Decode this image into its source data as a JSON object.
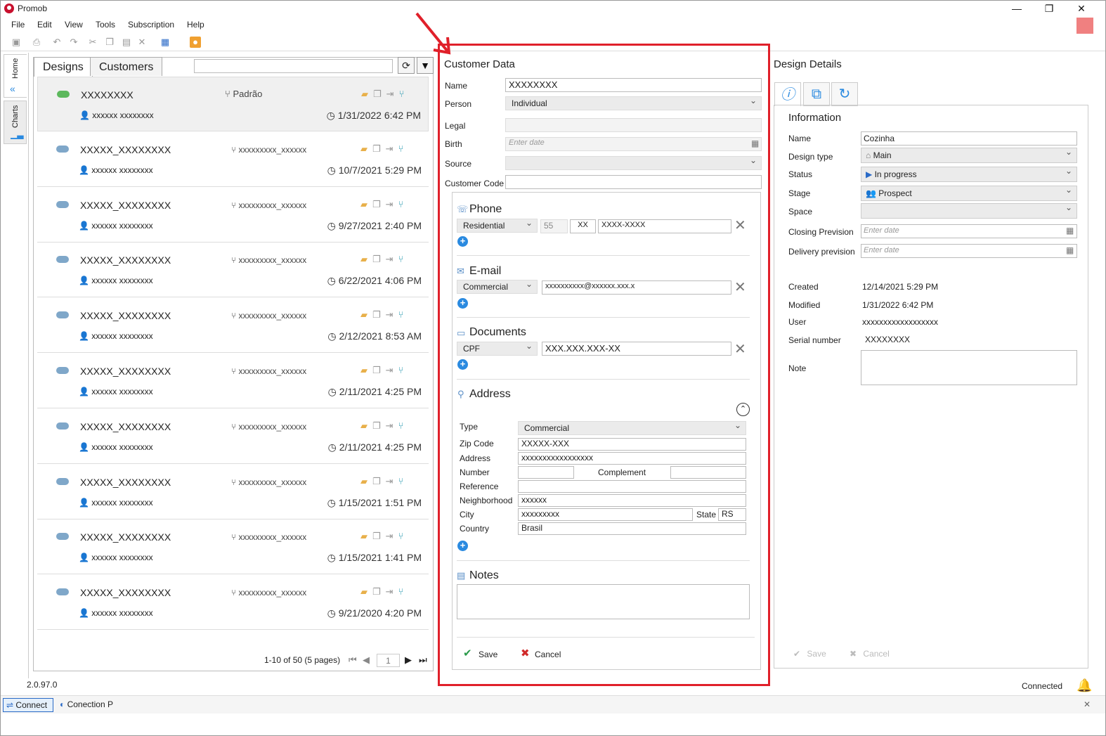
{
  "window": {
    "title": "Promob"
  },
  "menu": [
    "File",
    "Edit",
    "View",
    "Tools",
    "Subscription",
    "Help"
  ],
  "side_tabs": [
    "Home",
    "Charts"
  ],
  "designs_panel": {
    "tabs": [
      "Designs",
      "Customers"
    ],
    "rows": [
      {
        "name": "XXXXXXXX",
        "user": "xxxxxx xxxxxxxx",
        "branch": "Padrão",
        "date": "1/31/2022 6:42 PM",
        "cloud": "green"
      },
      {
        "name": "XXXXX_XXXXXXXX",
        "user": "xxxxxx xxxxxxxx",
        "branch": "xxxxxxxxx_xxxxxx",
        "date": "10/7/2021 5:29 PM",
        "cloud": "blue"
      },
      {
        "name": "XXXXX_XXXXXXXX",
        "user": "xxxxxx xxxxxxxx",
        "branch": "xxxxxxxxx_xxxxxx",
        "date": "9/27/2021 2:40 PM",
        "cloud": "blue"
      },
      {
        "name": "XXXXX_XXXXXXXX",
        "user": "xxxxxx xxxxxxxx",
        "branch": "xxxxxxxxx_xxxxxx",
        "date": "6/22/2021 4:06 PM",
        "cloud": "blue"
      },
      {
        "name": "XXXXX_XXXXXXXX",
        "user": "xxxxxx xxxxxxxx",
        "branch": "xxxxxxxxx_xxxxxx",
        "date": "2/12/2021 8:53 AM",
        "cloud": "blue"
      },
      {
        "name": "XXXXX_XXXXXXXX",
        "user": "xxxxxx xxxxxxxx",
        "branch": "xxxxxxxxx_xxxxxx",
        "date": "2/11/2021 4:25 PM",
        "cloud": "blue"
      },
      {
        "name": "XXXXX_XXXXXXXX",
        "user": "xxxxxx xxxxxxxx",
        "branch": "xxxxxxxxx_xxxxxx",
        "date": "2/11/2021 4:25 PM",
        "cloud": "blue"
      },
      {
        "name": "XXXXX_XXXXXXXX",
        "user": "xxxxxx xxxxxxxx",
        "branch": "xxxxxxxxx_xxxxxx",
        "date": "1/15/2021 1:51 PM",
        "cloud": "blue"
      },
      {
        "name": "XXXXX_XXXXXXXX",
        "user": "xxxxxx xxxxxxxx",
        "branch": "xxxxxxxxx_xxxxxx",
        "date": "1/15/2021 1:41 PM",
        "cloud": "blue"
      },
      {
        "name": "XXXXX_XXXXXXXX",
        "user": "xxxxxx xxxxxxxx",
        "branch": "xxxxxxxxx_xxxxxx",
        "date": "9/21/2020 4:20 PM",
        "cloud": "blue"
      }
    ],
    "pager": {
      "summary": "1-10 of 50 (5 pages)",
      "page": "1"
    }
  },
  "customer": {
    "title": "Customer Data",
    "name_label": "Name",
    "name_value": "XXXXXXXX",
    "person_label": "Person",
    "person_value": "Individual",
    "legal_label": "Legal",
    "birth_label": "Birth",
    "birth_placeholder": "Enter date",
    "source_label": "Source",
    "code_label": "Customer Code",
    "phone": {
      "title": "Phone",
      "type": "Residential",
      "country": "55",
      "area": "XX",
      "number": "XXXX-XXXX"
    },
    "email": {
      "title": "E-mail",
      "type": "Commercial",
      "value": "xxxxxxxxxx@xxxxxx.xxx.x"
    },
    "documents": {
      "title": "Documents",
      "type": "CPF",
      "value": "XXX.XXX.XXX-XX"
    },
    "address": {
      "title": "Address",
      "type_label": "Type",
      "type_value": "Commercial",
      "zip_label": "Zip Code",
      "zip_value": "XXXXX-XXX",
      "address_label": "Address",
      "address_value": "xxxxxxxxxxxxxxxxx",
      "number_label": "Number",
      "complement_label": "Complement",
      "reference_label": "Reference",
      "neighborhood_label": "Neighborhood",
      "neighborhood_value": "xxxxxx",
      "city_label": "City",
      "city_value": "xxxxxxxxx",
      "state_label": "State",
      "state_value": "RS",
      "country_label": "Country",
      "country_value": "Brasil"
    },
    "notes_title": "Notes",
    "save": "Save",
    "cancel": "Cancel"
  },
  "design_details": {
    "title": "Design Details",
    "section": "Information",
    "name_label": "Name",
    "name_value": "Cozinha",
    "type_label": "Design type",
    "type_value": "Main",
    "status_label": "Status",
    "status_value": "In progress",
    "stage_label": "Stage",
    "stage_value": "Prospect",
    "space_label": "Space",
    "closing_label": "Closing Prevision",
    "closing_placeholder": "Enter date",
    "delivery_label": "Delivery prevision",
    "delivery_placeholder": "Enter date",
    "created_label": "Created",
    "created_value": "12/14/2021 5:29 PM",
    "modified_label": "Modified",
    "modified_value": "1/31/2022 6:42 PM",
    "user_label": "User",
    "user_value": "xxxxxxxxxxxxxxxxxx",
    "serial_label": "Serial number",
    "serial_value": "XXXXXXXX",
    "note_label": "Note",
    "save": "Save",
    "cancel": "Cancel"
  },
  "status": {
    "version": "2.0.97.0",
    "connection": "Connected"
  },
  "taskbar": [
    "Connect",
    "Conection P"
  ],
  "colors": {
    "highlight": "#e0202a",
    "accent": "#2a8ae0"
  }
}
